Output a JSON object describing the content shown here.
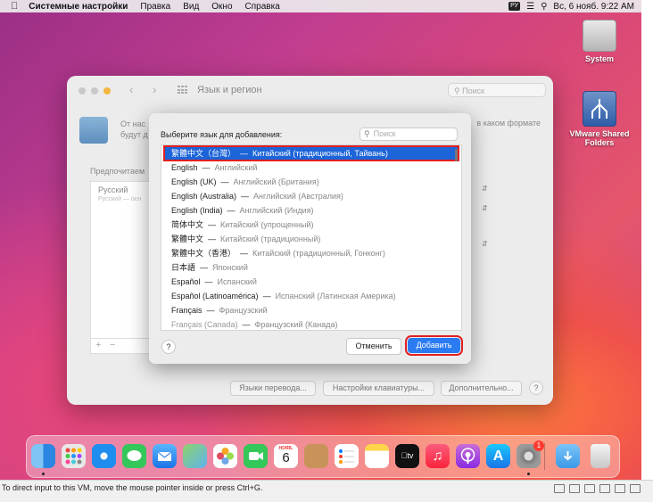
{
  "menubar": {
    "app_name": "Системные настройки",
    "items": [
      "Правка",
      "Вид",
      "Окно",
      "Справка"
    ],
    "input_source": "РУ",
    "clock": "Вс, 6 нояб.  9:22 AM"
  },
  "desktop": {
    "icons": [
      {
        "label": "System"
      },
      {
        "label": "VMware Shared Folders"
      }
    ]
  },
  "pref_window": {
    "title": "Язык и регион",
    "search_placeholder": "Поиск",
    "description_start": "От нас",
    "description_start2": "будут д",
    "description_end": "в каком формате",
    "preferred_label": "Предпочитаем",
    "preferred_language": "Русский",
    "preferred_language_sub": "Русский — осн",
    "buttons": {
      "translation": "Языки перевода...",
      "keyboard": "Настройки клавиатуры...",
      "advanced": "Дополнительно...",
      "help": "?"
    },
    "add_sign": "+",
    "remove_sign": "−"
  },
  "sheet": {
    "prompt": "Выберите язык для добавления:",
    "search_placeholder": "Поиск",
    "separator": "—",
    "languages": [
      {
        "native": "繁體中文（台灣）",
        "translation": "Китайский (традиционный, Тайвань)"
      },
      {
        "native": "English",
        "translation": "Английский"
      },
      {
        "native": "English (UK)",
        "translation": "Английский (Британия)"
      },
      {
        "native": "English (Australia)",
        "translation": "Английский (Австралия)"
      },
      {
        "native": "English (India)",
        "translation": "Английский (Индия)"
      },
      {
        "native": "简体中文",
        "translation": "Китайский (упрощенный)"
      },
      {
        "native": "繁體中文",
        "translation": "Китайский (традиционный)"
      },
      {
        "native": "繁體中文（香港）",
        "translation": "Китайский (традиционный, Гонконг)"
      },
      {
        "native": "日本語",
        "translation": "Японский"
      },
      {
        "native": "Español",
        "translation": "Испанский"
      },
      {
        "native": "Español (Latinoamérica)",
        "translation": "Испанский (Латинская Америка)"
      },
      {
        "native": "Français",
        "translation": "Французский"
      },
      {
        "native": "Français (Canada)",
        "translation": "Французский (Канада)"
      }
    ],
    "help": "?",
    "cancel": "Отменить",
    "add": "Добавить"
  },
  "dock": {
    "calendar_month": "НОЯБ.",
    "calendar_day": "6",
    "settings_badge": "1",
    "apps": [
      "finder-icon",
      "launchpad-icon",
      "safari-icon",
      "messages-icon",
      "mail-icon",
      "maps-icon",
      "photos-icon",
      "facetime-icon",
      "calendar-icon",
      "contacts-icon",
      "reminders-icon",
      "notes-icon",
      "apple-tv-icon",
      "music-icon",
      "podcasts-icon",
      "app-store-icon",
      "system-preferences-icon",
      "downloads-folder-icon",
      "trash-icon"
    ]
  },
  "vm_status": {
    "message": "To direct input to this VM, move the mouse pointer inside or press Ctrl+G."
  }
}
